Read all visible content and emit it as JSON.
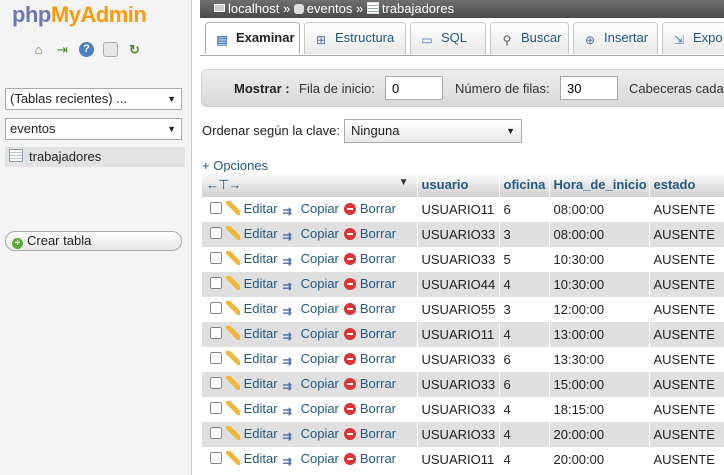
{
  "nav": {
    "logo_php": "php",
    "logo_admin": "MyAdmin",
    "recent_select": "(Tablas recientes) ...",
    "db_select": "eventos",
    "tree_table": "trabajadores",
    "create_table": "Crear tabla",
    "icons": [
      "home-icon",
      "logout-icon",
      "help-icon",
      "docs-icon",
      "reload-icon"
    ]
  },
  "breadcrumb": {
    "server": "localhost",
    "database": "eventos",
    "table": "trabajadores",
    "separator": "»"
  },
  "tabs": [
    {
      "label": "Examinar",
      "icon": "browse-icon"
    },
    {
      "label": "Estructura",
      "icon": "structure-icon"
    },
    {
      "label": "SQL",
      "icon": "sql-icon"
    },
    {
      "label": "Buscar",
      "icon": "search-icon"
    },
    {
      "label": "Insertar",
      "icon": "insert-icon"
    },
    {
      "label": "Expo",
      "icon": "export-icon"
    }
  ],
  "toolbar": {
    "show_label": "Mostrar :",
    "start_row_label": "Fila de inicio:",
    "start_row_value": "0",
    "num_rows_label": "Número de filas:",
    "num_rows_value": "30",
    "headers_label": "Cabeceras cada"
  },
  "sort": {
    "label": "Ordenar según la clave:",
    "value": "Ninguna"
  },
  "options_link": "+ Opciones",
  "actions": {
    "edit": "Editar",
    "copy": "Copiar",
    "delete": "Borrar"
  },
  "columns": [
    "usuario",
    "oficina",
    "Hora_de_inicio",
    "estado"
  ],
  "rows": [
    [
      "USUARIO11",
      "6",
      "08:00:00",
      "AUSENTE"
    ],
    [
      "USUARIO33",
      "3",
      "08:00:00",
      "AUSENTE"
    ],
    [
      "USUARIO33",
      "5",
      "10:30:00",
      "AUSENTE"
    ],
    [
      "USUARIO44",
      "4",
      "10:30:00",
      "AUSENTE"
    ],
    [
      "USUARIO55",
      "3",
      "12:00:00",
      "AUSENTE"
    ],
    [
      "USUARIO11",
      "4",
      "13:00:00",
      "AUSENTE"
    ],
    [
      "USUARIO33",
      "6",
      "13:30:00",
      "AUSENTE"
    ],
    [
      "USUARIO33",
      "6",
      "15:00:00",
      "AUSENTE"
    ],
    [
      "USUARIO33",
      "4",
      "18:15:00",
      "AUSENTE"
    ],
    [
      "USUARIO33",
      "4",
      "20:00:00",
      "AUSENTE"
    ],
    [
      "USUARIO11",
      "4",
      "20:00:00",
      "AUSENTE"
    ]
  ]
}
